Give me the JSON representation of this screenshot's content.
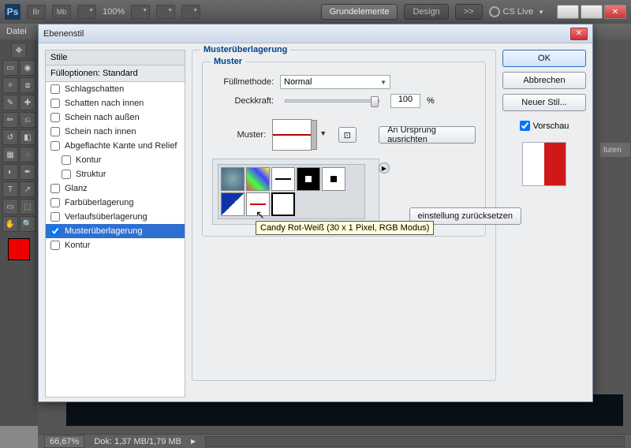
{
  "app_bar": {
    "logo": "Ps",
    "buttons": [
      "Br",
      "Mb"
    ],
    "zoom": "100%",
    "tabs": {
      "active": "Grundelemente",
      "inactive": "Design",
      "more": ">>"
    },
    "cs_live": "CS Live"
  },
  "menu": {
    "file": "Datei"
  },
  "right_panel": {
    "tab": "turen"
  },
  "status": {
    "zoom": "66,67%",
    "doc": "Dok: 1,37 MB/1,79 MB"
  },
  "dialog": {
    "title": "Ebenenstil",
    "styles_header": "Stile",
    "fill_options": "Fülloptionen: Standard",
    "items": [
      {
        "label": "Schlagschatten",
        "checked": false,
        "indent": false
      },
      {
        "label": "Schatten nach innen",
        "checked": false,
        "indent": false
      },
      {
        "label": "Schein nach außen",
        "checked": false,
        "indent": false
      },
      {
        "label": "Schein nach innen",
        "checked": false,
        "indent": false
      },
      {
        "label": "Abgeflachte Kante und Relief",
        "checked": false,
        "indent": false
      },
      {
        "label": "Kontur",
        "checked": false,
        "indent": true
      },
      {
        "label": "Struktur",
        "checked": false,
        "indent": true
      },
      {
        "label": "Glanz",
        "checked": false,
        "indent": false
      },
      {
        "label": "Farbüberlagerung",
        "checked": false,
        "indent": false
      },
      {
        "label": "Verlaufsüberlagerung",
        "checked": false,
        "indent": false
      },
      {
        "label": "Musterüberlagerung",
        "checked": true,
        "indent": false,
        "active": true
      },
      {
        "label": "Kontur",
        "checked": false,
        "indent": false
      }
    ],
    "main_section": "Musterüberlagerung",
    "sub_section": "Muster",
    "fields": {
      "fill_method_label": "Füllmethode:",
      "fill_method_value": "Normal",
      "opacity_label": "Deckkraft:",
      "opacity_value": "100",
      "opacity_unit": "%",
      "pattern_label": "Muster:"
    },
    "buttons": {
      "ok": "OK",
      "cancel": "Abbrechen",
      "new_style": "Neuer Stil...",
      "preview": "Vorschau",
      "snap_origin": "An Ursprung ausrichten",
      "reset_default": "einstellung zurücksetzen"
    },
    "tooltip": "Candy Rot-Weiß (30 x 1 Pixel, RGB Modus)",
    "preview_colors": {
      "left": "#ffffff",
      "right": "#d01818"
    }
  }
}
